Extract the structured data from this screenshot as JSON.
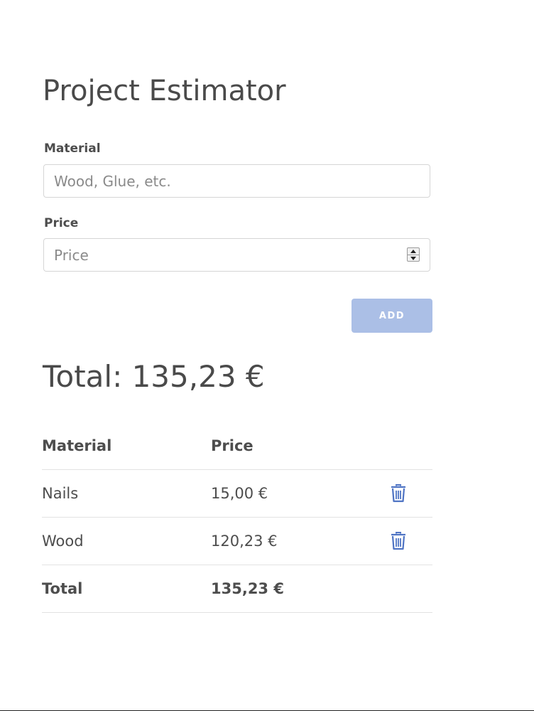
{
  "app": {
    "title": "Project Estimator"
  },
  "form": {
    "material": {
      "label": "Material",
      "placeholder": "Wood, Glue, etc.",
      "value": ""
    },
    "price": {
      "label": "Price",
      "placeholder": "Price",
      "value": ""
    },
    "add_label": "ADD"
  },
  "summary": {
    "total_text": "Total: 135,23 €"
  },
  "table": {
    "headers": {
      "material": "Material",
      "price": "Price"
    },
    "rows": [
      {
        "material": "Nails",
        "price": "15,00 €",
        "action_icon": "trash-icon"
      },
      {
        "material": "Wood",
        "price": "120,23 €",
        "action_icon": "trash-icon"
      }
    ],
    "footer": {
      "label": "Total",
      "value": "135,23 €"
    }
  },
  "colors": {
    "accent": "#4f74c4",
    "button_disabled": "#abbfe6",
    "text": "#4d4d4d"
  }
}
